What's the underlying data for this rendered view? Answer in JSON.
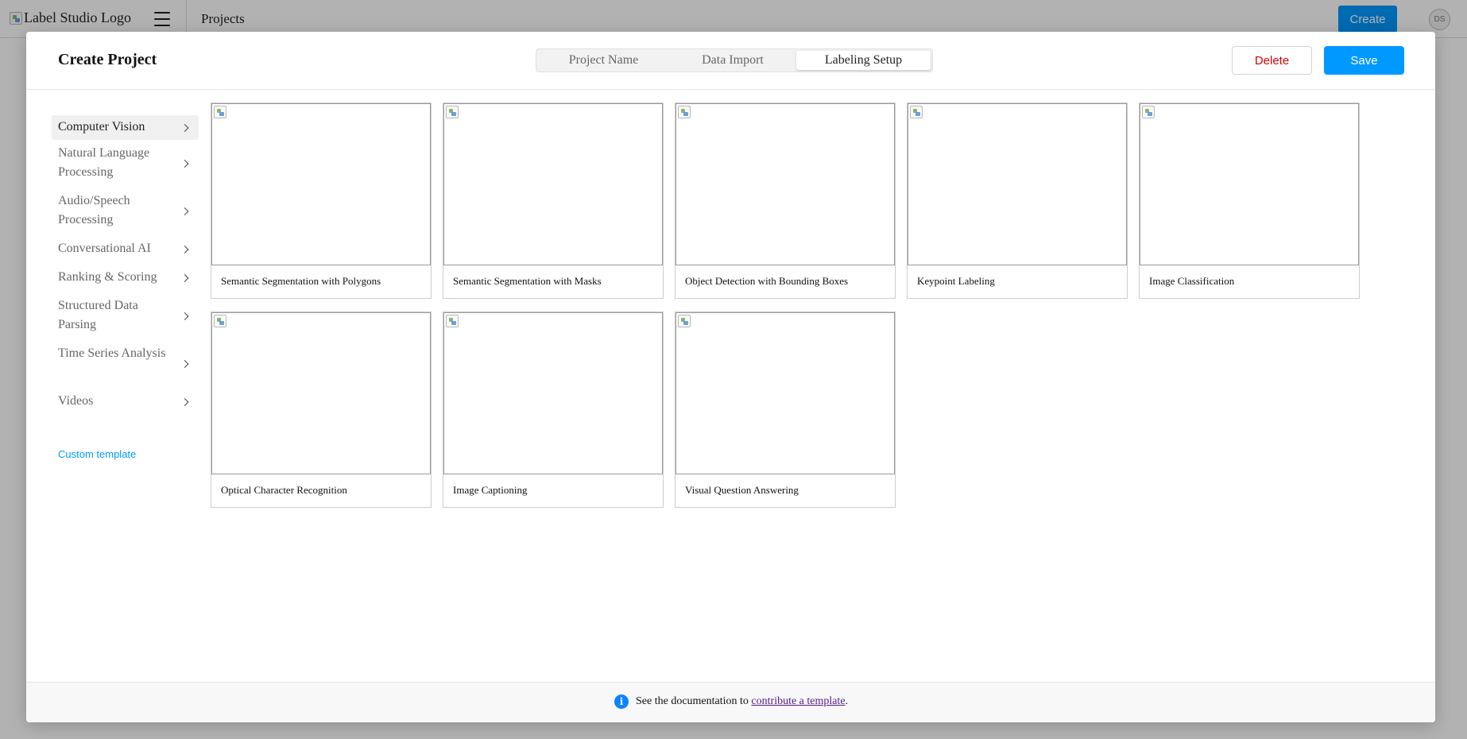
{
  "app": {
    "logo_alt": "Label Studio Logo",
    "page_title": "Projects",
    "create_label": "Create",
    "avatar_initials": "DS"
  },
  "modal": {
    "title": "Create Project",
    "steps": [
      {
        "label": "Project Name",
        "active": false
      },
      {
        "label": "Data Import",
        "active": false
      },
      {
        "label": "Labeling Setup",
        "active": true
      }
    ],
    "delete_label": "Delete",
    "save_label": "Save"
  },
  "sidebar": {
    "categories": [
      {
        "label": "Computer Vision",
        "active": true
      },
      {
        "label": "Natural Language Processing",
        "active": false
      },
      {
        "label": "Audio/Speech Processing",
        "active": false
      },
      {
        "label": "Conversational AI",
        "active": false
      },
      {
        "label": "Ranking & Scoring",
        "active": false
      },
      {
        "label": "Structured Data Parsing",
        "active": false
      },
      {
        "label": "Time Series Analysis",
        "active": false
      },
      {
        "label": "Videos",
        "active": false
      }
    ],
    "custom_template_label": "Custom template"
  },
  "templates": [
    "Semantic Segmentation with Polygons",
    "Semantic Segmentation with Masks",
    "Object Detection with Bounding Boxes",
    "Keypoint Labeling",
    "Image Classification",
    "Optical Character Recognition",
    "Image Captioning",
    "Visual Question Answering"
  ],
  "footer": {
    "text_before": "See the documentation to",
    "link_text": "contribute a template",
    "text_after": "."
  },
  "colors": {
    "primary": "#0099ff",
    "danger": "#dd0000",
    "link_visited": "#551a8b"
  }
}
